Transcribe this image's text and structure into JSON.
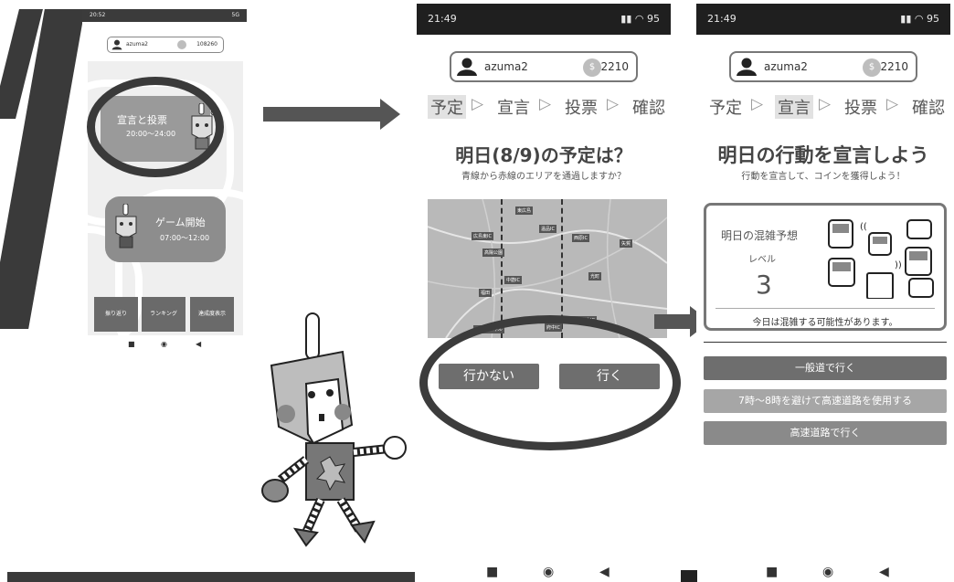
{
  "phone1": {
    "status_time": "20:52",
    "status_right": "5G",
    "username": "azuma2",
    "coins": "108260",
    "btn_declare_title": "宣言と投票",
    "btn_declare_time": "20:00〜24:00",
    "btn_game_title": "ゲーム開始",
    "btn_game_time": "07:00〜12:00",
    "tabs": [
      "振り返り",
      "ランキング",
      "達成度表示"
    ]
  },
  "phone2": {
    "status_time": "21:49",
    "username": "azuma2",
    "coins": "2210",
    "steps": [
      "予定",
      "宣言",
      "投票",
      "確認"
    ],
    "title": "明日(8/9)の予定は？",
    "subtitle": "青線から赤線のエリアを通過しますか？",
    "map_labels": [
      "広島東IC",
      "高陽公園",
      "温品IC",
      "中筋IC",
      "福田",
      "西原IC",
      "矢賀",
      "光町",
      "中山トンネル",
      "府中IC",
      "安芸府中IC",
      "東広島"
    ],
    "choices": [
      "行かない",
      "行く"
    ]
  },
  "phone3": {
    "status_time": "21:49",
    "username": "azuma2",
    "coins": "2210",
    "steps": [
      "予定",
      "宣言",
      "投票",
      "確認"
    ],
    "title": "明日の行動を宣言しよう",
    "subtitle": "行動を宣言して、コインを獲得しよう！",
    "card_title": "明日の混雑予想",
    "card_level_label": "レベル",
    "card_level_value": "3",
    "card_foot": "今日は混雑する可能性があります。",
    "options": [
      "一般道で行く",
      "7時〜8時を避けて高速道路を使用する",
      "高速道路で行く"
    ]
  },
  "nav_glyphs": {
    "square": "■",
    "circle": "◉",
    "back": "◀"
  },
  "colors": {
    "dark": "#3a3a3a",
    "button": "#6e6e6e",
    "status": "#1f1f1f"
  }
}
